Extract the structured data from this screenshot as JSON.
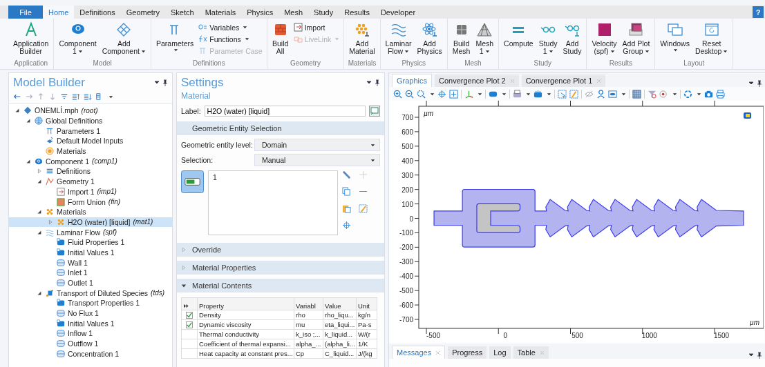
{
  "menu_tabs": [
    {
      "label": "File",
      "kind": "file",
      "selected": false
    },
    {
      "label": "Home",
      "kind": "tab",
      "selected": true
    },
    {
      "label": "Definitions",
      "kind": "tab",
      "selected": false
    },
    {
      "label": "Geometry",
      "kind": "tab",
      "selected": false
    },
    {
      "label": "Sketch",
      "kind": "tab",
      "selected": false
    },
    {
      "label": "Materials",
      "kind": "tab",
      "selected": false
    },
    {
      "label": "Physics",
      "kind": "tab",
      "selected": false
    },
    {
      "label": "Mesh",
      "kind": "tab",
      "selected": false
    },
    {
      "label": "Study",
      "kind": "tab",
      "selected": false
    },
    {
      "label": "Results",
      "kind": "tab",
      "selected": false
    },
    {
      "label": "Developer",
      "kind": "tab",
      "selected": false
    }
  ],
  "help": "?",
  "ribbon": {
    "groups": [
      {
        "name": "Application",
        "buttons": [
          {
            "lines": [
              "Application",
              "Builder"
            ],
            "dropdown": false
          }
        ]
      },
      {
        "name": "Model",
        "buttons": [
          {
            "lines": [
              "Component",
              "1"
            ],
            "dropdown": true
          },
          {
            "lines": [
              "Add",
              "Component"
            ],
            "dropdown": true
          }
        ]
      },
      {
        "name": "Definitions",
        "buttons": [
          {
            "lines": [
              "Parameters"
            ],
            "dropdown": true
          }
        ],
        "small": [
          {
            "label": "Variables",
            "dropdown": true,
            "disabled": false
          },
          {
            "label": "Functions",
            "dropdown": true,
            "disabled": false
          },
          {
            "label": "Parameter Case",
            "dropdown": false,
            "disabled": true
          }
        ]
      },
      {
        "name": "Geometry",
        "buttons": [
          {
            "lines": [
              "Build",
              "All"
            ],
            "dropdown": false
          }
        ],
        "small": [
          {
            "label": "Import",
            "dropdown": false,
            "disabled": false
          },
          {
            "label": "LiveLink",
            "dropdown": true,
            "disabled": true
          }
        ]
      },
      {
        "name": "Materials",
        "buttons": [
          {
            "lines": [
              "Add",
              "Material"
            ],
            "dropdown": false
          }
        ]
      },
      {
        "name": "Physics",
        "buttons": [
          {
            "lines": [
              "Laminar",
              "Flow"
            ],
            "dropdown": true
          },
          {
            "lines": [
              "Add",
              "Physics"
            ],
            "dropdown": false
          }
        ]
      },
      {
        "name": "Mesh",
        "buttons": [
          {
            "lines": [
              "Build",
              "Mesh"
            ],
            "dropdown": false
          },
          {
            "lines": [
              "Mesh",
              "1"
            ],
            "dropdown": true
          }
        ]
      },
      {
        "name": "Study",
        "buttons": [
          {
            "lines": [
              "Compute"
            ],
            "dropdown": false
          },
          {
            "lines": [
              "Study",
              "1"
            ],
            "dropdown": true
          },
          {
            "lines": [
              "Add",
              "Study"
            ],
            "dropdown": false
          }
        ]
      },
      {
        "name": "Results",
        "buttons": [
          {
            "lines": [
              "Velocity",
              "(spf)"
            ],
            "dropdown": true
          },
          {
            "lines": [
              "Add Plot",
              "Group"
            ],
            "dropdown": true
          }
        ]
      },
      {
        "name": "Layout",
        "buttons": [
          {
            "lines": [
              "Windows"
            ],
            "dropdown": true
          },
          {
            "lines": [
              "Reset",
              "Desktop"
            ],
            "dropdown": true
          }
        ]
      }
    ]
  },
  "model_builder": {
    "title": "Model Builder",
    "tree": [
      {
        "label": "ÖNEMLİ.mph",
        "tag": "(root)",
        "expanded": true,
        "selected": false,
        "children": [
          {
            "label": "Global Definitions",
            "expanded": true,
            "selected": false,
            "children": [
              {
                "label": "Parameters 1",
                "selected": false
              },
              {
                "label": "Default Model Inputs",
                "selected": false
              },
              {
                "label": "Materials",
                "selected": false
              }
            ]
          },
          {
            "label": "Component 1",
            "tag": "(comp1)",
            "expanded": true,
            "selected": false,
            "children": [
              {
                "label": "Definitions",
                "expanded": false,
                "selected": false
              },
              {
                "label": "Geometry 1",
                "expanded": true,
                "selected": false,
                "children": [
                  {
                    "label": "Import 1",
                    "tag": "(imp1)",
                    "selected": false
                  },
                  {
                    "label": "Form Union",
                    "tag": "(fin)",
                    "selected": false
                  }
                ]
              },
              {
                "label": "Materials",
                "expanded": true,
                "selected": false,
                "children": [
                  {
                    "label": "H2O (water) [liquid]",
                    "tag": "(mat1)",
                    "expanded": false,
                    "selected": true
                  }
                ]
              },
              {
                "label": "Laminar Flow",
                "tag": "(spf)",
                "expanded": true,
                "selected": false,
                "children": [
                  {
                    "label": "Fluid Properties 1",
                    "selected": false
                  },
                  {
                    "label": "Initial Values 1",
                    "selected": false
                  },
                  {
                    "label": "Wall 1",
                    "selected": false
                  },
                  {
                    "label": "Inlet 1",
                    "selected": false
                  },
                  {
                    "label": "Outlet 1",
                    "selected": false
                  }
                ]
              },
              {
                "label": "Transport of Diluted Species",
                "tag": "(tds)",
                "expanded": true,
                "selected": false,
                "children": [
                  {
                    "label": "Transport Properties 1",
                    "selected": false
                  },
                  {
                    "label": "No Flux 1",
                    "selected": false
                  },
                  {
                    "label": "Initial Values 1",
                    "selected": false
                  },
                  {
                    "label": "Inflow 1",
                    "selected": false
                  },
                  {
                    "label": "Outflow 1",
                    "selected": false
                  },
                  {
                    "label": "Concentration 1",
                    "selected": false
                  }
                ]
              }
            ]
          }
        ]
      }
    ]
  },
  "settings": {
    "title": "Settings",
    "subtitle": "Material",
    "label_caption": "Label:",
    "label_value": "H2O (water) [liquid]",
    "selection_section": "Geometric Entity Selection",
    "fields": [
      {
        "label": "Geometric entity level:",
        "value": "Domain"
      },
      {
        "label": "Selection:",
        "value": "Manual"
      }
    ],
    "selection_items": [
      "1"
    ],
    "sections": [
      {
        "title": "Override",
        "expanded": false
      },
      {
        "title": "Material Properties",
        "expanded": false
      },
      {
        "title": "Material Contents",
        "expanded": true
      }
    ],
    "table": {
      "columns": [
        "Property",
        "Variabl",
        "Value",
        "Unit"
      ],
      "rows": [
        {
          "checked": true,
          "cells": [
            "Density",
            "rho",
            "rho_liqu...",
            "kg/n"
          ]
        },
        {
          "checked": true,
          "cells": [
            "Dynamic viscosity",
            "mu",
            "eta_liqui...",
            "Pa·s"
          ]
        },
        {
          "checked": false,
          "cells": [
            "Thermal conductivity",
            "k_iso ;...",
            "k_liquid...",
            "W/(r"
          ]
        },
        {
          "checked": false,
          "cells": [
            "Coefficient of thermal expansi...",
            "alpha_...",
            "(alpha_li...",
            "1/K"
          ]
        },
        {
          "checked": false,
          "cells": [
            "Heat capacity at constant pres...",
            "Cp",
            "C_liquid...",
            "J/(kg"
          ]
        }
      ]
    }
  },
  "graphics": {
    "tabs": [
      {
        "label": "Graphics",
        "closable": false,
        "selected": true
      },
      {
        "label": "Convergence Plot 2",
        "closable": true,
        "selected": false
      },
      {
        "label": "Convergence Plot 1",
        "closable": true,
        "selected": false
      }
    ],
    "unit_top": "µm",
    "unit_bottom": "µm",
    "y_ticks": [
      "700",
      "600",
      "500",
      "400",
      "300",
      "200",
      "100",
      "0",
      "-100",
      "-200",
      "-300",
      "-400",
      "-500",
      "-600",
      "-700"
    ],
    "x_ticks": [
      "-500",
      "0",
      "500",
      "1000",
      "1500"
    ]
  },
  "bottom_tabs": [
    {
      "label": "Messages",
      "closable": true,
      "selected": true
    },
    {
      "label": "Progress",
      "closable": false,
      "selected": false
    },
    {
      "label": "Log",
      "closable": false,
      "selected": false
    },
    {
      "label": "Table",
      "closable": true,
      "selected": false
    }
  ]
}
